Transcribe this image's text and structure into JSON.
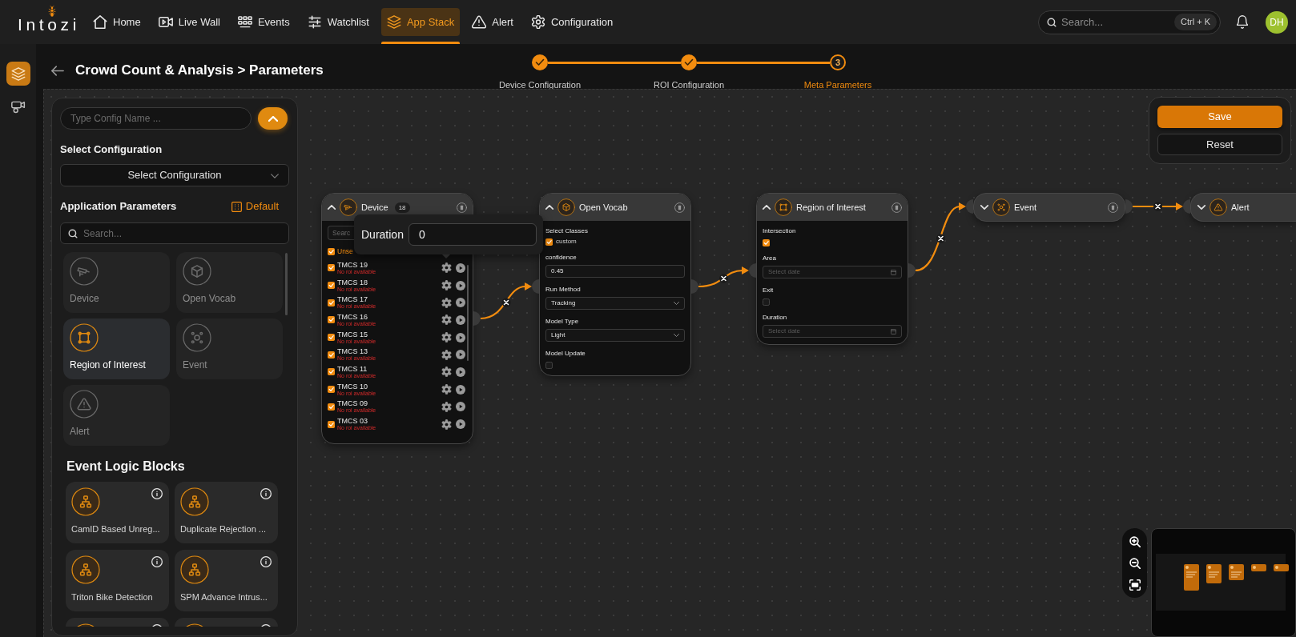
{
  "nav": {
    "logo": "Intozi",
    "items": [
      {
        "label": "Home",
        "selected": false
      },
      {
        "label": "Live Wall",
        "selected": false
      },
      {
        "label": "Events",
        "selected": false
      },
      {
        "label": "Watchlist",
        "selected": false
      },
      {
        "label": "App Stack",
        "selected": true
      },
      {
        "label": "Alert",
        "selected": false
      },
      {
        "label": "Configuration",
        "selected": false
      }
    ],
    "search": {
      "placeholder": "Search...",
      "shortcut": "Ctrl + K"
    },
    "user": {
      "initials": "DH"
    }
  },
  "sidebar": {
    "items": [
      {
        "selected": true
      },
      {
        "selected": false
      }
    ]
  },
  "page": {
    "title": "Crowd Count & Analysis > Parameters"
  },
  "stepper": {
    "steps": [
      {
        "label": "Device Configuration",
        "completed": true,
        "selected": false
      },
      {
        "label": "ROI Configuration",
        "completed": true,
        "selected": false
      },
      {
        "label": "Meta Parameters",
        "number": "3",
        "completed": false,
        "selected": true
      }
    ]
  },
  "config_panel": {
    "config_name": {
      "placeholder": "Type Config Name ..."
    },
    "select_configuration": {
      "label": "Select Configuration",
      "value": "Select Configuration"
    },
    "application_parameters": {
      "title": "Application Parameters",
      "default_button": "Default",
      "search": {
        "placeholder": "Search..."
      },
      "blocks": [
        {
          "kind": "device",
          "label": "Device",
          "selected": false
        },
        {
          "kind": "open_vocab",
          "label": "Open Vocab",
          "selected": false
        },
        {
          "kind": "roi",
          "label": "Region of Interest",
          "selected": true
        },
        {
          "kind": "event",
          "label": "Event",
          "selected": false
        },
        {
          "kind": "alert",
          "label": "Alert",
          "selected": false
        }
      ]
    },
    "event_logic_blocks": {
      "title": "Event Logic Blocks",
      "blocks": [
        {
          "kind": "full",
          "label": "CamID Based Unreg..."
        },
        {
          "kind": "full",
          "label": "Duplicate Rejection ..."
        },
        {
          "kind": "full",
          "label": "Triton Bike Detection"
        },
        {
          "kind": "full",
          "label": "SPM Advance Intrus..."
        },
        {
          "kind": "cut_off"
        },
        {
          "kind": "cut_off"
        }
      ]
    }
  },
  "actions": [
    {
      "kind": "primary",
      "label": "Save"
    },
    {
      "kind": "secondary",
      "label": "Reset"
    }
  ],
  "nodes": [
    {
      "kind": "device",
      "title": "Device",
      "count": "18",
      "expanded": true,
      "search": {
        "placeholder": "Searc"
      },
      "select_all": {
        "label": "Unse",
        "checked": true
      },
      "popover": {
        "label": "Duration",
        "value": "0"
      },
      "devices": [
        {
          "name": "TMCS 19",
          "status": "No roi available",
          "checked": true
        },
        {
          "name": "TMCS 18",
          "status": "No roi available",
          "checked": true
        },
        {
          "name": "TMCS 17",
          "status": "No roi available",
          "checked": true
        },
        {
          "name": "TMCS 16",
          "status": "No roi available",
          "checked": true
        },
        {
          "name": "TMCS 15",
          "status": "No roi available",
          "checked": true
        },
        {
          "name": "TMCS 13",
          "status": "No roi available",
          "checked": true
        },
        {
          "name": "TMCS 11",
          "status": "No roi available",
          "checked": true
        },
        {
          "name": "TMCS 10",
          "status": "No roi available",
          "checked": true
        },
        {
          "name": "TMCS 09",
          "status": "No roi available",
          "checked": true
        },
        {
          "name": "TMCS 03",
          "status": "No roi available",
          "checked": true
        }
      ]
    },
    {
      "kind": "open_vocab",
      "title": "Open Vocab",
      "expanded": true,
      "fields": [
        {
          "kind": "checkboxes",
          "label": "Select Classes",
          "options": [
            {
              "label": "custom",
              "checked": true
            }
          ]
        },
        {
          "kind": "text",
          "label": "confidence",
          "value": "0.45"
        },
        {
          "kind": "select",
          "label": "Run Method",
          "value": "Tracking"
        },
        {
          "kind": "select",
          "label": "Model Type",
          "value": "Light"
        },
        {
          "kind": "checkbox",
          "label": "Model Update",
          "checked": false
        }
      ]
    },
    {
      "kind": "roi",
      "title": "Region of Interest",
      "expanded": true,
      "fields": [
        {
          "kind": "checkbox",
          "label": "Intersection",
          "checked": true
        },
        {
          "kind": "date",
          "label": "Area",
          "placeholder": "Select date"
        },
        {
          "kind": "checkbox",
          "label": "Exit",
          "checked": false
        },
        {
          "kind": "date",
          "label": "Duration",
          "placeholder": "Select date"
        }
      ]
    },
    {
      "kind": "event",
      "title": "Event",
      "expanded": false
    },
    {
      "kind": "alert",
      "title": "Alert",
      "expanded": false
    }
  ]
}
